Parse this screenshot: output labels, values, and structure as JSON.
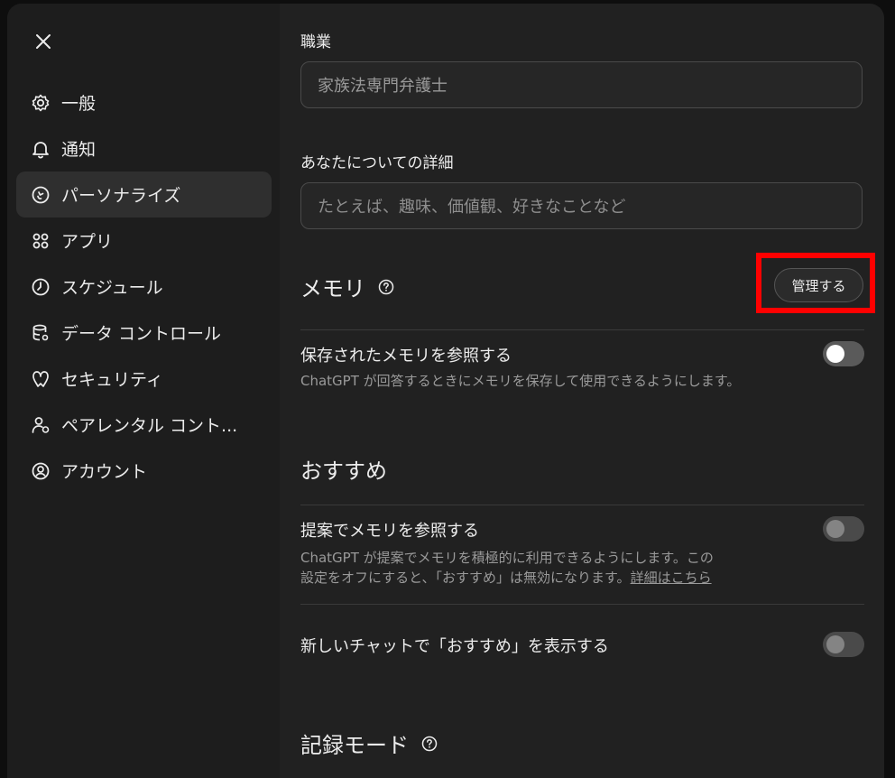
{
  "sidebar": {
    "close_label": "×",
    "items": [
      {
        "label": "一般",
        "icon": "gear-icon"
      },
      {
        "label": "通知",
        "icon": "bell-icon"
      },
      {
        "label": "パーソナライズ",
        "icon": "personalize-icon"
      },
      {
        "label": "アプリ",
        "icon": "apps-grid-icon"
      },
      {
        "label": "スケジュール",
        "icon": "clock-icon"
      },
      {
        "label": "データ コントロール",
        "icon": "database-icon"
      },
      {
        "label": "セキュリティ",
        "icon": "shield-icon"
      },
      {
        "label": "ペアレンタル コント...",
        "icon": "parental-icon"
      },
      {
        "label": "アカウント",
        "icon": "account-icon"
      }
    ],
    "active_index": 2
  },
  "profile": {
    "occupation_label": "職業",
    "occupation_value": "家族法専門弁護士",
    "about_label": "あなたについての詳細",
    "about_placeholder": "たとえば、趣味、価値観、好きなことなど"
  },
  "memory": {
    "title": "メモリ",
    "manage_label": "管理する",
    "saved_title": "保存されたメモリを参照する",
    "saved_desc": "ChatGPT が回答するときにメモリを保存して使用できるようにします。",
    "saved_enabled": false
  },
  "recommend": {
    "title": "おすすめ",
    "suggest_title": "提案でメモリを参照する",
    "suggest_desc_1": "ChatGPT が提案でメモリを積極的に利用できるようにします。この",
    "suggest_desc_2": "設定をオフにすると、「おすすめ」は無効になります。",
    "suggest_link": "詳細はこちら",
    "suggest_enabled": false,
    "new_chat_title": "新しいチャットで「おすすめ」を表示する",
    "new_chat_enabled": false
  },
  "record": {
    "title": "記録モード"
  }
}
